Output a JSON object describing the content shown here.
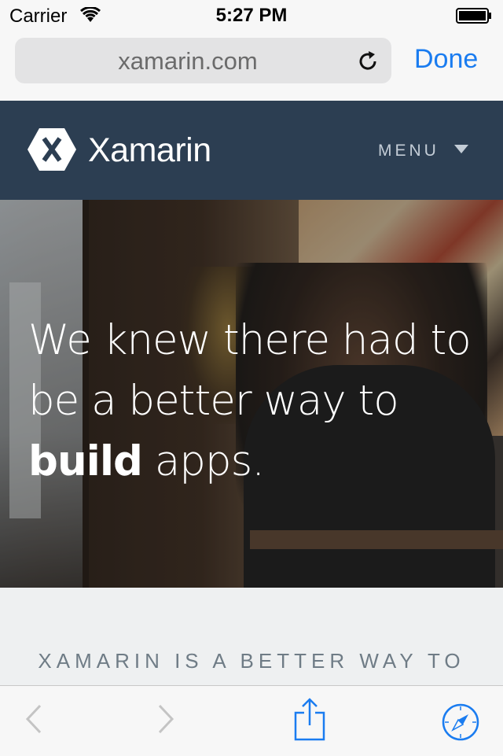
{
  "status_bar": {
    "carrier": "Carrier",
    "time": "5:27 PM",
    "wifi_icon": "wifi-icon",
    "battery_icon": "battery-icon"
  },
  "browser": {
    "url": "xamarin.com",
    "done_label": "Done",
    "reload_icon": "reload-icon"
  },
  "site_header": {
    "brand": "Xamarin",
    "menu_label": "MENU",
    "logo_letter": "X"
  },
  "hero": {
    "line1": "We knew there had to",
    "line2": "be a better way to",
    "line3_bold": "build",
    "line3_rest": "apps."
  },
  "section": {
    "heading": "XAMARIN IS A BETTER WAY TO"
  },
  "toolbar": {
    "back_icon": "back-chevron-icon",
    "forward_icon": "forward-chevron-icon",
    "share_icon": "share-icon",
    "compass_icon": "safari-compass-icon"
  },
  "colors": {
    "accent": "#1a7cf0",
    "header_bg": "#2c3e52",
    "page_bg": "#eef0f1"
  }
}
